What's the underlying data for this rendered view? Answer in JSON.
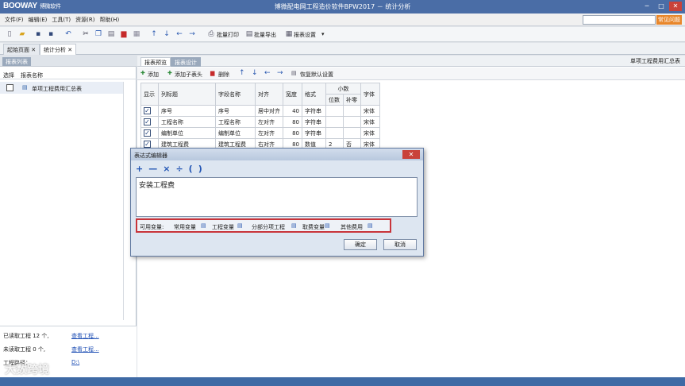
{
  "app": {
    "logo": "BOOWAY",
    "logo_sub": "博微软件",
    "title": "博微配电网工程造价软件BPW2017 － 统计分析",
    "search_button": "常见问题"
  },
  "menu": [
    "文件(F)",
    "编辑(E)",
    "工具(T)",
    "资源(R)",
    "帮助(H)"
  ],
  "toolbar": {
    "print_label": "批量打印",
    "export_label": "批量导出",
    "settings_label": "报表设置"
  },
  "doc_tabs": [
    {
      "label": "起始页面",
      "close": "✕"
    },
    {
      "label": "统计分析",
      "close": "✕"
    }
  ],
  "left_panel": {
    "tab": "报表列表",
    "col_select": "选择",
    "col_name": "报表名称",
    "items": [
      {
        "name": "单项工程费用汇总表"
      }
    ]
  },
  "right_panel": {
    "tab_preview": "报表预览",
    "tab_design": "报表设计",
    "title": "单项工程费用汇总表",
    "toolbar": {
      "add": "添加",
      "add_child": "添加子表头",
      "delete": "删除",
      "restore": "恢复默认设置"
    },
    "grid": {
      "headers": {
        "show": "显示",
        "col_title": "列标题",
        "field": "字段名称",
        "align": "对齐",
        "width": "宽度",
        "format": "格式",
        "decimal": "小数",
        "digits": "位数",
        "pad_zero": "补零",
        "font": "字体"
      },
      "rows": [
        {
          "title": "序号",
          "field": "序号",
          "align": "居中对齐",
          "width": "40",
          "format": "字符串",
          "digits": "",
          "pad": "",
          "font": "宋体"
        },
        {
          "title": "工程名称",
          "field": "工程名称",
          "align": "左对齐",
          "width": "80",
          "format": "字符串",
          "digits": "",
          "pad": "",
          "font": "宋体"
        },
        {
          "title": "编制单位",
          "field": "编制单位",
          "align": "左对齐",
          "width": "80",
          "format": "字符串",
          "digits": "",
          "pad": "",
          "font": "宋体"
        },
        {
          "title": "建筑工程费",
          "field": "建筑工程费",
          "align": "右对齐",
          "width": "80",
          "format": "数值",
          "digits": "2",
          "pad": "否",
          "font": "宋体"
        }
      ]
    }
  },
  "dialog": {
    "title": "表达式编辑器",
    "close": "✕",
    "operators": [
      "+",
      "—",
      "×",
      "÷",
      "(",
      ")"
    ],
    "expression": "安装工程费",
    "vars_label": "可用变量:",
    "vars": [
      "常用变量",
      "工程变量",
      "分部分项工程",
      "取费变量",
      "其他费用"
    ],
    "ok": "确定",
    "cancel": "取消"
  },
  "status": {
    "selected_label": "已读取工程 12 个,",
    "selected_link": "查看工程...",
    "unread_label": "未读取工程 0 个,",
    "unread_link": "查看工程...",
    "path_label": "工程路径：",
    "path_value": "D:\\"
  },
  "watermark": "大数跨境"
}
